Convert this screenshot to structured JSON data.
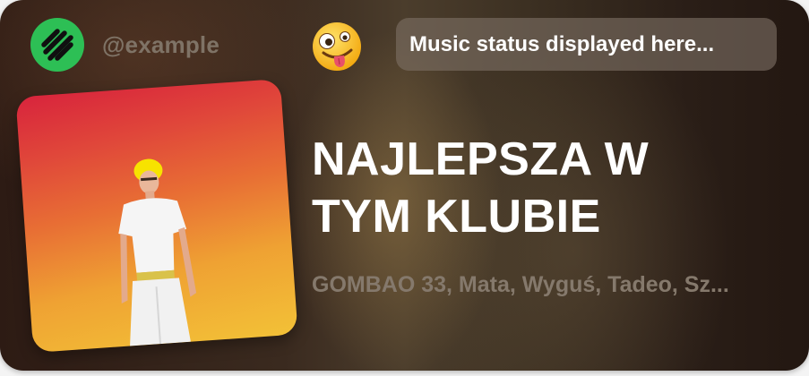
{
  "profile": {
    "username": "@example",
    "logo_icon": "striped-logo-icon",
    "logo_color": "#2dbf55",
    "status_emoji_icon": "zany-face-emoji-icon"
  },
  "status": {
    "text": "Music status displayed here..."
  },
  "track": {
    "title_line1": "NAJLEPSZA W",
    "title_line2": "TYM KLUBIE",
    "artists": "GOMBAO 33, Mata, Wyguś, Tadeo, Sz..."
  },
  "album_art": {
    "icon": "album-cover-image",
    "colors": [
      "#d8243c",
      "#e86f34",
      "#f3c137"
    ]
  }
}
